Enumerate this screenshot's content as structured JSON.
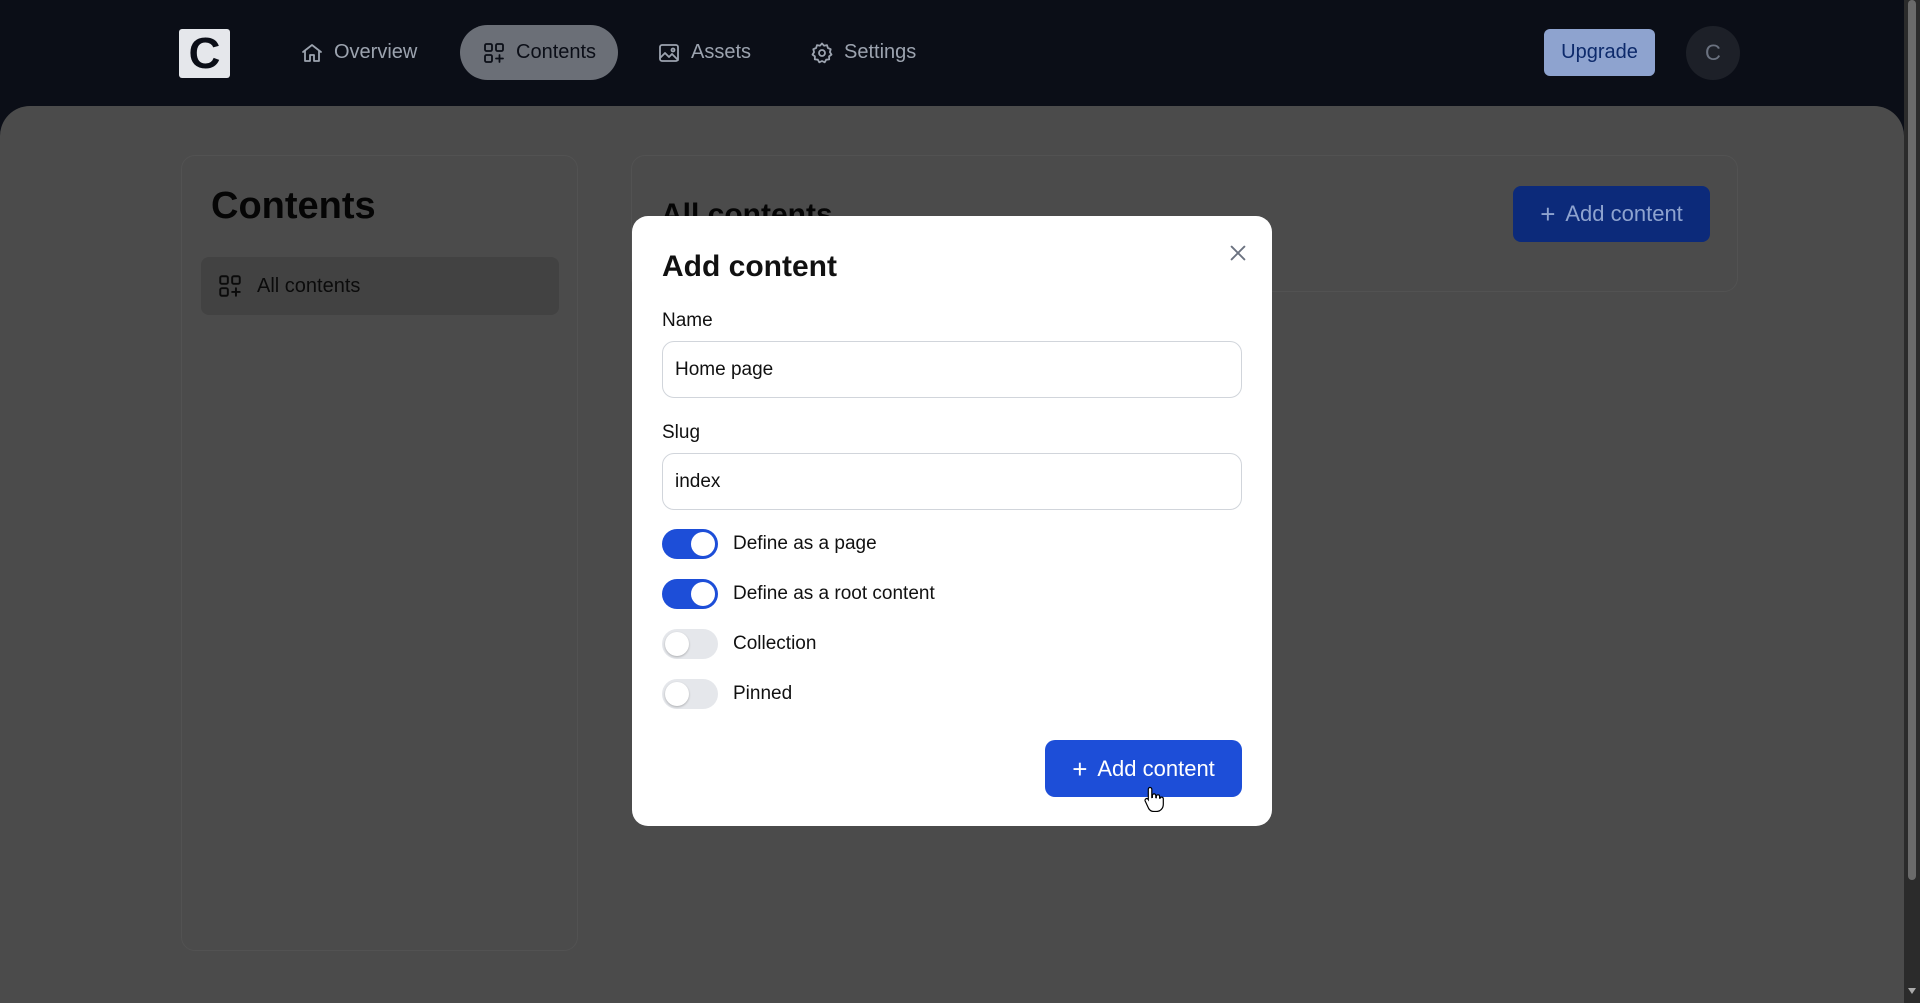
{
  "app": {
    "logo_letter": "C",
    "brand_color": "#1d4ed8"
  },
  "nav": {
    "items": [
      {
        "label": "Overview",
        "icon": "home-icon",
        "active": false
      },
      {
        "label": "Contents",
        "icon": "grid-plus-icon",
        "active": true
      },
      {
        "label": "Assets",
        "icon": "image-icon",
        "active": false
      },
      {
        "label": "Settings",
        "icon": "gear-icon",
        "active": false
      }
    ],
    "upgrade_label": "Upgrade",
    "avatar_initial": "C"
  },
  "sidebar": {
    "title": "Contents",
    "items": [
      {
        "label": "All contents",
        "icon": "grid-plus-icon"
      }
    ]
  },
  "main": {
    "title": "All contents",
    "add_button_label": "Add content"
  },
  "modal": {
    "title": "Add content",
    "name_label": "Name",
    "name_value": "Home page",
    "slug_label": "Slug",
    "slug_value": "index",
    "toggles": [
      {
        "label": "Define as a page",
        "on": true
      },
      {
        "label": "Define as a root content",
        "on": true
      },
      {
        "label": "Collection",
        "on": false
      },
      {
        "label": "Pinned",
        "on": false
      }
    ],
    "submit_label": "Add content"
  }
}
